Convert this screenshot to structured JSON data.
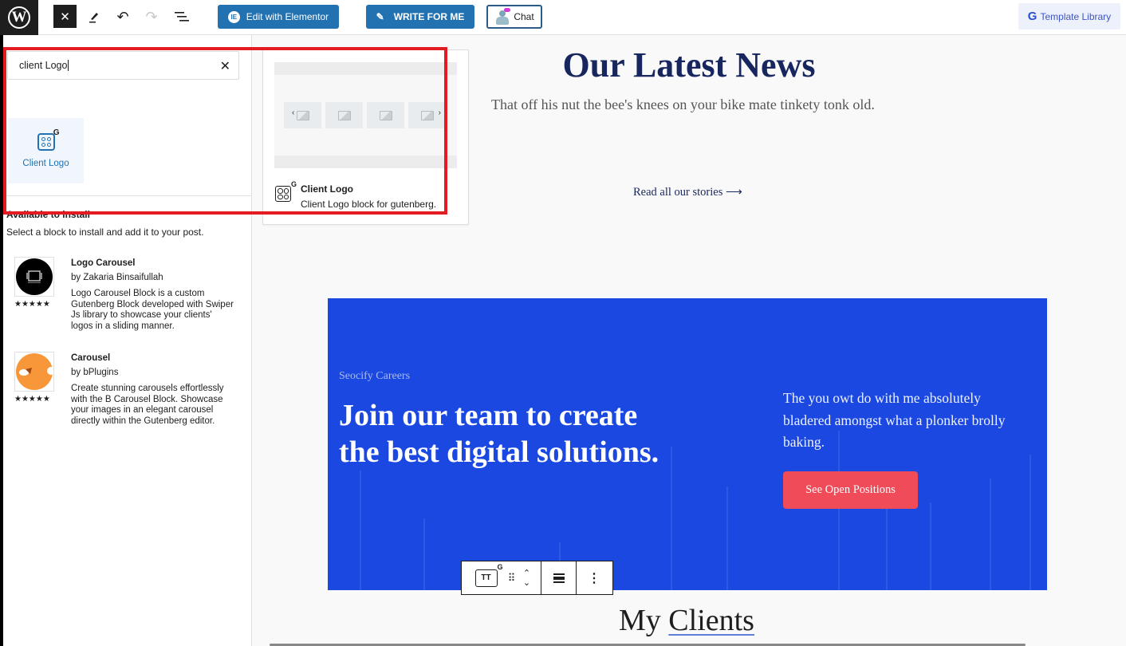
{
  "toolbar": {
    "wp_logo": "W",
    "close_icon": "✕",
    "undo_icon": "↶",
    "redo_icon": "↷",
    "elementor_label": "Edit with Elementor",
    "elementor_icon": "IE",
    "write_label": "WRITE FOR ME",
    "write_icon": "✎",
    "chat_label": "Chat",
    "template_label": "Template Library",
    "template_icon": "G"
  },
  "inserter": {
    "search_value": "client Logo",
    "clear_icon": "✕",
    "result_block": {
      "label": "Client Logo",
      "badge": "G"
    },
    "available_title": "Available to install",
    "available_desc": "Select a block to install and add it to your post.",
    "plugins": [
      {
        "name": "Logo Carousel",
        "author": "by Zakaria Binsaifullah",
        "description": "Logo Carousel Block is a custom Gutenberg Block developed with Swiper Js library to showcase your clients' logos in a sliding manner.",
        "rating_stars": "★★★★★",
        "rating": 5,
        "thumb_color": "#000000"
      },
      {
        "name": "Carousel",
        "author": "by bPlugins",
        "description": "Create stunning carousels effortlessly with the B Carousel Block. Showcase your images in an elegant carousel directly within the Gutenberg editor.",
        "rating_stars": "★★★★★",
        "rating": 5,
        "thumb_color": "#f7973a"
      }
    ]
  },
  "preview": {
    "title": "Client Logo",
    "description": "Client Logo block for gutenberg.",
    "prev_arrow": "‹",
    "next_arrow": "›",
    "badge": "G"
  },
  "canvas": {
    "news_title": "Our Latest News",
    "news_subtitle": "That off his nut the bee's knees on your bike mate tinkety tonk old.",
    "read_all": "Read all our stories ⟶",
    "careers": {
      "kicker": "Seocify Careers",
      "headline": "Join our team to create the best digital solutions.",
      "body": "The you owt do with me absolutely bladered amongst what a plonker brolly baking.",
      "cta": "See Open Positions",
      "bg_color": "#1b48e0",
      "cta_color": "#ef4b58"
    },
    "block_toolbar": {
      "type_icon": "TT",
      "badge": "G",
      "drag_icon": "⠿",
      "move_up": "⌃",
      "move_down": "⌄",
      "more_icon": "⋮"
    },
    "clients_title_prefix": "My",
    "clients_title_link": "Clients"
  },
  "colors": {
    "accent": "#2271b1",
    "heading": "#17265e",
    "highlight": "#e31b23"
  }
}
